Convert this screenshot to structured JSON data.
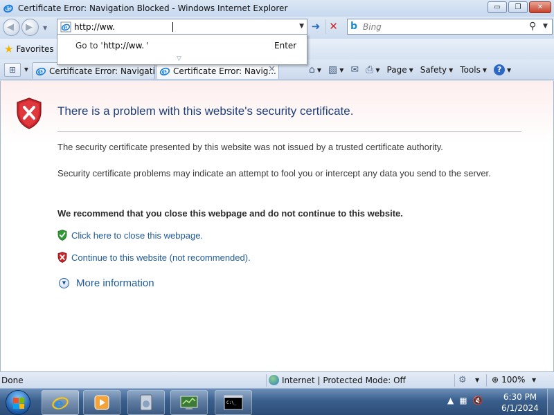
{
  "window": {
    "title": "Certificate Error: Navigation Blocked - Windows Internet Explorer",
    "minimize": "▭",
    "maximize": "❐",
    "close": "✕"
  },
  "address_bar": {
    "value": "http://ww.",
    "go_arrow": "➜",
    "stop": "✕"
  },
  "search": {
    "placeholder": "Bing",
    "button": "⚲"
  },
  "autocomplete": {
    "go_to_prefix": "Go to '",
    "url": "http://ww.",
    "close_quote": "'",
    "enter_label": "Enter"
  },
  "favorites": {
    "label": "Favorites"
  },
  "tabs": [
    {
      "title": "Certificate Error: Navigatio..."
    },
    {
      "title": "Certificate Error: Navig..."
    }
  ],
  "toolbar": {
    "page": "Page",
    "safety": "Safety",
    "tools": "Tools",
    "help": "?"
  },
  "page": {
    "title": "There is a problem with this website's security certificate.",
    "para1": "The security certificate presented by this website was not issued by a trusted certificate authority.",
    "para2": "Security certificate problems may indicate an attempt to fool you or intercept any data you send to the server.",
    "recommend": "We recommend that you close this webpage and do not continue to this website.",
    "close_link": "Click here to close this webpage.",
    "continue_link": "Continue to this website (not recommended).",
    "more_info": "More information"
  },
  "statusbar": {
    "status": "Done",
    "zone": "Internet | Protected Mode: Off",
    "zoom": "100%"
  },
  "taskbar": {
    "time": "6:30 PM",
    "date": "6/1/2024"
  },
  "colors": {
    "link": "#1f5a99",
    "title": "#1f3f7a",
    "error_red": "#c8262a",
    "ok_green": "#2f9a35"
  }
}
